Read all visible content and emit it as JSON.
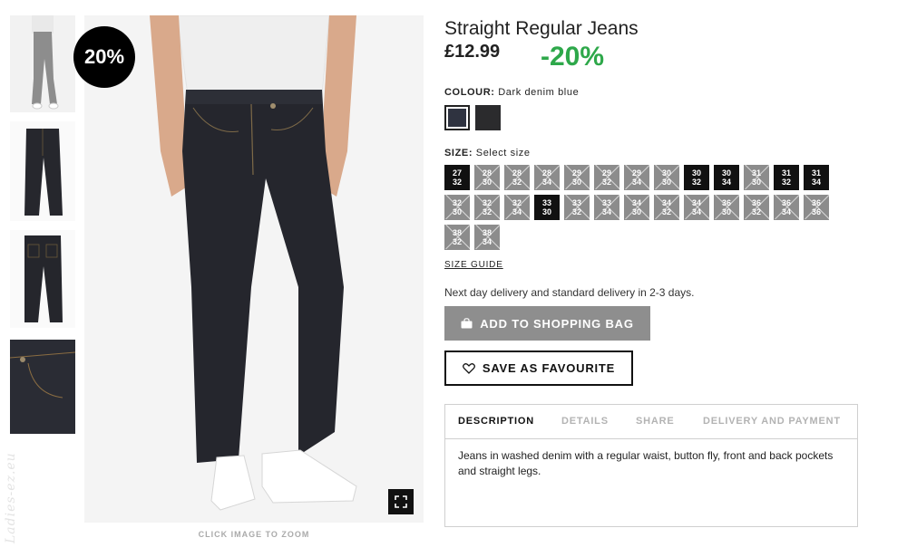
{
  "thumbnails": [
    {
      "name": "model-grey-jeans",
      "icon": "thumbnail-model-grey"
    },
    {
      "name": "jeans-front",
      "icon": "thumbnail-jeans-front"
    },
    {
      "name": "jeans-back",
      "icon": "thumbnail-jeans-back"
    },
    {
      "name": "denim-detail",
      "icon": "thumbnail-denim-detail"
    }
  ],
  "watermark": "Ladies-ez.eu",
  "main_image": {
    "discount_badge": "20%",
    "zoom_hint": "CLICK IMAGE TO ZOOM"
  },
  "product": {
    "title": "Straight Regular Jeans",
    "price": "£12.99",
    "discount": "-20%",
    "discount_color": "#2ea84a"
  },
  "colour": {
    "label": "COLOUR:",
    "selected": "Dark denim blue",
    "swatches": [
      {
        "name": "dark-denim-blue",
        "color": "#2f3340",
        "selected": true
      },
      {
        "name": "black-denim",
        "color": "#2b2b2d",
        "selected": false
      }
    ]
  },
  "size": {
    "label": "SIZE:",
    "value": "Select size",
    "options": [
      {
        "w": "27",
        "l": "32",
        "available": true
      },
      {
        "w": "28",
        "l": "30",
        "available": false
      },
      {
        "w": "28",
        "l": "32",
        "available": false
      },
      {
        "w": "28",
        "l": "34",
        "available": false
      },
      {
        "w": "29",
        "l": "30",
        "available": false
      },
      {
        "w": "29",
        "l": "32",
        "available": false
      },
      {
        "w": "29",
        "l": "34",
        "available": false
      },
      {
        "w": "30",
        "l": "30",
        "available": false
      },
      {
        "w": "30",
        "l": "32",
        "available": true
      },
      {
        "w": "30",
        "l": "34",
        "available": true
      },
      {
        "w": "31",
        "l": "30",
        "available": false
      },
      {
        "w": "31",
        "l": "32",
        "available": true
      },
      {
        "w": "31",
        "l": "34",
        "available": true
      },
      {
        "w": "32",
        "l": "30",
        "available": false
      },
      {
        "w": "32",
        "l": "32",
        "available": false
      },
      {
        "w": "32",
        "l": "34",
        "available": false
      },
      {
        "w": "33",
        "l": "30",
        "available": true
      },
      {
        "w": "33",
        "l": "32",
        "available": false
      },
      {
        "w": "33",
        "l": "34",
        "available": false
      },
      {
        "w": "34",
        "l": "30",
        "available": false
      },
      {
        "w": "34",
        "l": "32",
        "available": false
      },
      {
        "w": "34",
        "l": "34",
        "available": false
      },
      {
        "w": "36",
        "l": "30",
        "available": false
      },
      {
        "w": "36",
        "l": "32",
        "available": false
      },
      {
        "w": "36",
        "l": "34",
        "available": false
      },
      {
        "w": "36",
        "l": "36",
        "available": false
      },
      {
        "w": "38",
        "l": "32",
        "available": false
      },
      {
        "w": "38",
        "l": "34",
        "available": false
      }
    ],
    "guide_label": "SIZE GUIDE"
  },
  "delivery_note": "Next day delivery and standard delivery in 2-3 days.",
  "actions": {
    "add_to_bag": "ADD TO SHOPPING BAG",
    "add_to_bag_icon": "shopping-bag-icon",
    "save_favourite": "SAVE AS FAVOURITE",
    "save_favourite_icon": "heart-icon"
  },
  "tabs": [
    {
      "label": "DESCRIPTION",
      "active": true
    },
    {
      "label": "DETAILS",
      "active": false
    },
    {
      "label": "SHARE",
      "active": false
    },
    {
      "label": "DELIVERY AND PAYMENT",
      "active": false
    }
  ],
  "description": "Jeans in washed denim with a regular waist, button fly, front and back pockets and straight legs."
}
